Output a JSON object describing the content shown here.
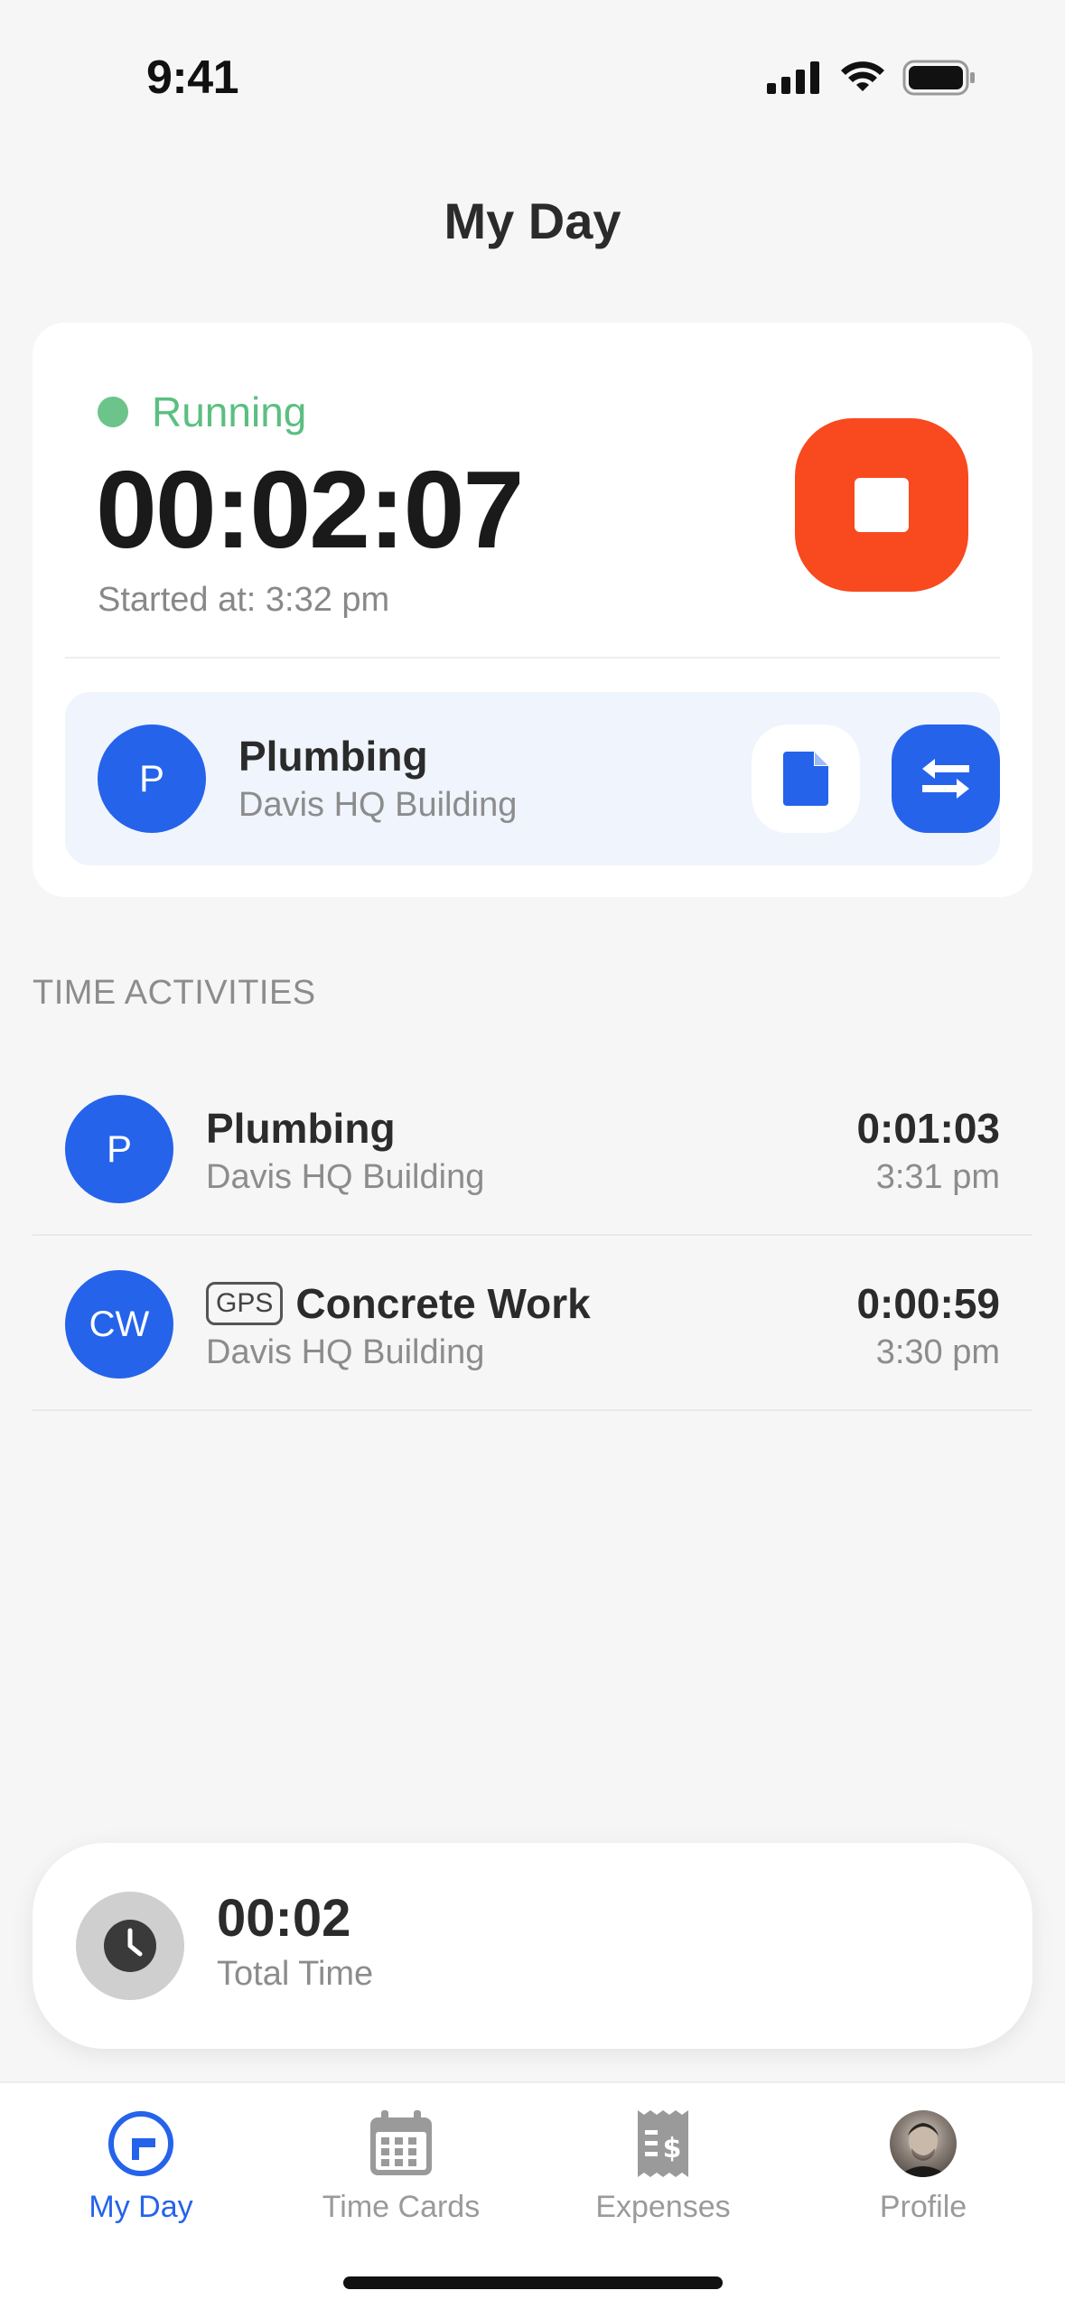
{
  "status_bar": {
    "time": "9:41"
  },
  "header": {
    "title": "My Day"
  },
  "timer": {
    "status": "Running",
    "elapsed": "00:02:07",
    "started_at": "Started at: 3:32 pm",
    "current_job": {
      "initials": "P",
      "name": "Plumbing",
      "site": "Davis HQ Building"
    }
  },
  "activities": {
    "section_title": "TIME ACTIVITIES",
    "items": [
      {
        "initials": "P",
        "name": "Plumbing",
        "site": "Davis HQ Building",
        "duration": "0:01:03",
        "start": "3:31 pm",
        "badge": ""
      },
      {
        "initials": "CW",
        "name": "Concrete Work",
        "site": "Davis HQ Building",
        "duration": "0:00:59",
        "start": "3:30 pm",
        "badge": "GPS"
      }
    ]
  },
  "total": {
    "value": "00:02",
    "label": "Total Time"
  },
  "tabs": [
    {
      "label": "My Day",
      "icon": "my-day-icon",
      "active": true
    },
    {
      "label": "Time Cards",
      "icon": "calendar-icon",
      "active": false
    },
    {
      "label": "Expenses",
      "icon": "receipt-icon",
      "active": false
    },
    {
      "label": "Profile",
      "icon": "profile-avatar",
      "active": false
    }
  ],
  "colors": {
    "accent": "#2563EB",
    "stop": "#F8491F",
    "running": "#5BBF80",
    "background": "#F6F6F6"
  }
}
